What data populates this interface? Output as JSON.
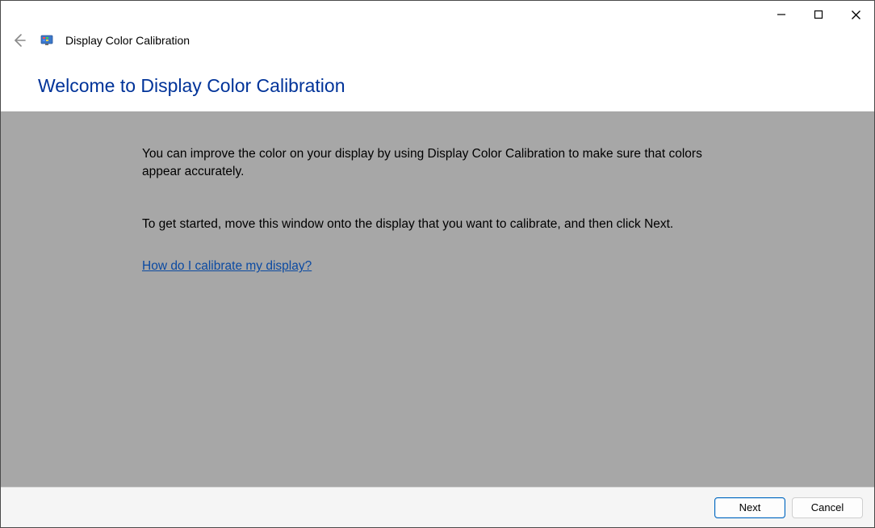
{
  "window": {
    "app_title": "Display Color Calibration"
  },
  "heading": "Welcome to Display Color Calibration",
  "body": {
    "para1": "You can improve the color on your display by using Display Color Calibration to make sure that colors appear accurately.",
    "para2": "To get started, move this window onto the display that you want to calibrate, and then click Next.",
    "help_link": "How do I calibrate my display?"
  },
  "buttons": {
    "next": "Next",
    "cancel": "Cancel"
  }
}
